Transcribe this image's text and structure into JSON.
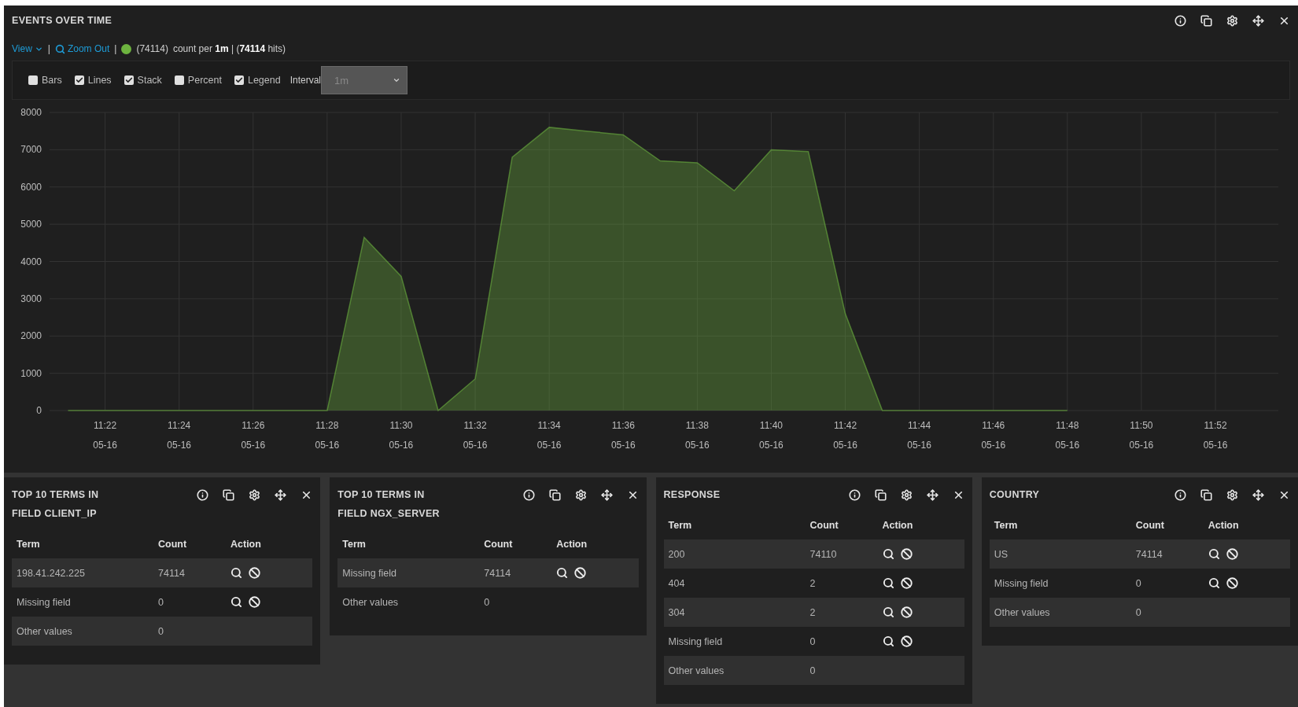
{
  "main_panel": {
    "title": "EVENTS OVER TIME",
    "info_bar": [
      {
        "kind": "menu",
        "text": "View"
      },
      {
        "kind": "separator",
        "text": "|"
      },
      {
        "kind": "link",
        "text": "Zoom Out"
      },
      {
        "kind": "separator",
        "text": "|"
      },
      {
        "kind": "legend"
      },
      {
        "kind": "plain",
        "text": "count per **1m** | (**74114** hits)"
      }
    ],
    "options": [
      {
        "label": "Bars",
        "checked": false
      },
      {
        "label": "Lines",
        "checked": true
      },
      {
        "label": "Stack",
        "checked": true
      },
      {
        "label": "Percent",
        "checked": false
      },
      {
        "label": "Legend",
        "checked": true
      }
    ],
    "interval": {
      "label": "Interval",
      "value": "1m"
    },
    "chart_data": {
      "type": "area",
      "categories": [
        null,
        "11:22 05-16",
        null,
        "11:24 05-16",
        null,
        "11:26 05-16",
        null,
        "11:28 05-16",
        null,
        "11:30 05-16",
        null,
        "11:32 05-16",
        null,
        "11:34 05-16",
        null,
        "11:36 05-16",
        null,
        "11:38 05-16",
        null,
        "11:40 05-16",
        null,
        "11:42 05-16",
        null,
        "11:44 05-16",
        null,
        "11:46 05-16",
        null,
        "11:48 05-16",
        null,
        "11:50 05-16",
        null,
        "11:52 05-16",
        null
      ],
      "series": [
        {
          "name": "(74114)",
          "color": "#6db33f",
          "values": [
            0,
            0,
            0,
            0,
            0,
            0,
            0,
            0,
            4650,
            3600,
            0,
            850,
            6800,
            7600,
            7500,
            7400,
            6700,
            6650,
            5900,
            7000,
            6950,
            2600,
            0,
            0,
            0,
            0,
            0,
            0,
            null,
            null,
            null,
            null,
            null
          ]
        }
      ],
      "ylim": [
        0,
        8000
      ],
      "grid": true,
      "yticks": [
        0,
        1000,
        2000,
        3000,
        4000,
        5000,
        6000,
        7000,
        8000
      ]
    }
  },
  "term_panels": [
    {
      "title": "TOP 10 TERMS IN FIELD CLIENT_IP",
      "columns": [
        "Term",
        "Count",
        "Action"
      ],
      "rows": [
        {
          "term": "198.41.242.225",
          "count": "74114",
          "actions": true
        },
        {
          "term": "Missing field",
          "count": "0",
          "actions": true
        },
        {
          "term": "Other values",
          "count": "0",
          "actions": false
        }
      ]
    },
    {
      "title": "TOP 10 TERMS IN FIELD NGX_SERVER",
      "columns": [
        "Term",
        "Count",
        "Action"
      ],
      "rows": [
        {
          "term": "Missing field",
          "count": "74114",
          "actions": true
        },
        {
          "term": "Other values",
          "count": "0",
          "actions": false
        }
      ]
    },
    {
      "title": "RESPONSE",
      "columns": [
        "Term",
        "Count",
        "Action"
      ],
      "rows": [
        {
          "term": "200",
          "count": "74110",
          "actions": true
        },
        {
          "term": "404",
          "count": "2",
          "actions": true
        },
        {
          "term": "304",
          "count": "2",
          "actions": true
        },
        {
          "term": "Missing field",
          "count": "0",
          "actions": true
        },
        {
          "term": "Other values",
          "count": "0",
          "actions": false
        }
      ]
    },
    {
      "title": "COUNTRY",
      "columns": [
        "Term",
        "Count",
        "Action"
      ],
      "rows": [
        {
          "term": "US",
          "count": "74114",
          "actions": true
        },
        {
          "term": "Missing field",
          "count": "0",
          "actions": true
        },
        {
          "term": "Other values",
          "count": "0",
          "actions": false
        }
      ]
    }
  ]
}
